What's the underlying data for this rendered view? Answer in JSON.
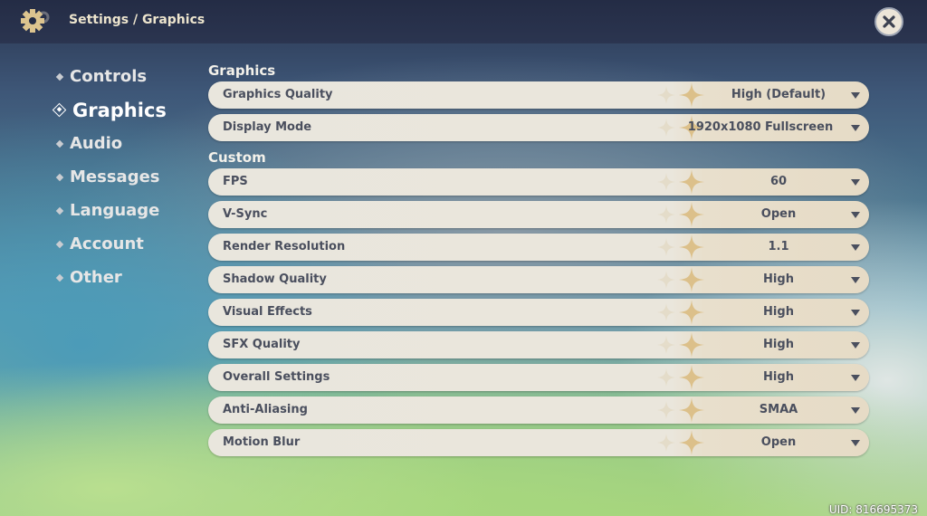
{
  "header": {
    "icon": "gear-icon",
    "breadcrumb": "Settings / Graphics",
    "close_icon": "close-icon"
  },
  "sidebar": {
    "items": [
      {
        "label": "Controls",
        "active": false
      },
      {
        "label": "Graphics",
        "active": true
      },
      {
        "label": "Audio",
        "active": false
      },
      {
        "label": "Messages",
        "active": false
      },
      {
        "label": "Language",
        "active": false
      },
      {
        "label": "Account",
        "active": false
      },
      {
        "label": "Other",
        "active": false
      }
    ]
  },
  "main": {
    "sections": [
      {
        "title": "Graphics",
        "settings": [
          {
            "label": "Graphics Quality",
            "value": "High (Default)"
          },
          {
            "label": "Display Mode",
            "value": "1920x1080 Fullscreen"
          }
        ]
      },
      {
        "title": "Custom",
        "settings": [
          {
            "label": "FPS",
            "value": "60"
          },
          {
            "label": "V-Sync",
            "value": "Open"
          },
          {
            "label": "Render Resolution",
            "value": "1.1"
          },
          {
            "label": "Shadow Quality",
            "value": "High"
          },
          {
            "label": "Visual Effects",
            "value": "High"
          },
          {
            "label": "SFX Quality",
            "value": "High"
          },
          {
            "label": "Overall Settings",
            "value": "High"
          },
          {
            "label": "Anti-Aliasing",
            "value": "SMAA"
          },
          {
            "label": "Motion Blur",
            "value": "Open"
          }
        ]
      }
    ]
  },
  "footer": {
    "uid": "UID: 816695373"
  },
  "colors": {
    "topbar": "#242c45",
    "row_bg": "#e9e6dd",
    "row_text": "#4a4f5e",
    "accent_gold": "#d9b779",
    "header_text": "#ece4cd"
  }
}
